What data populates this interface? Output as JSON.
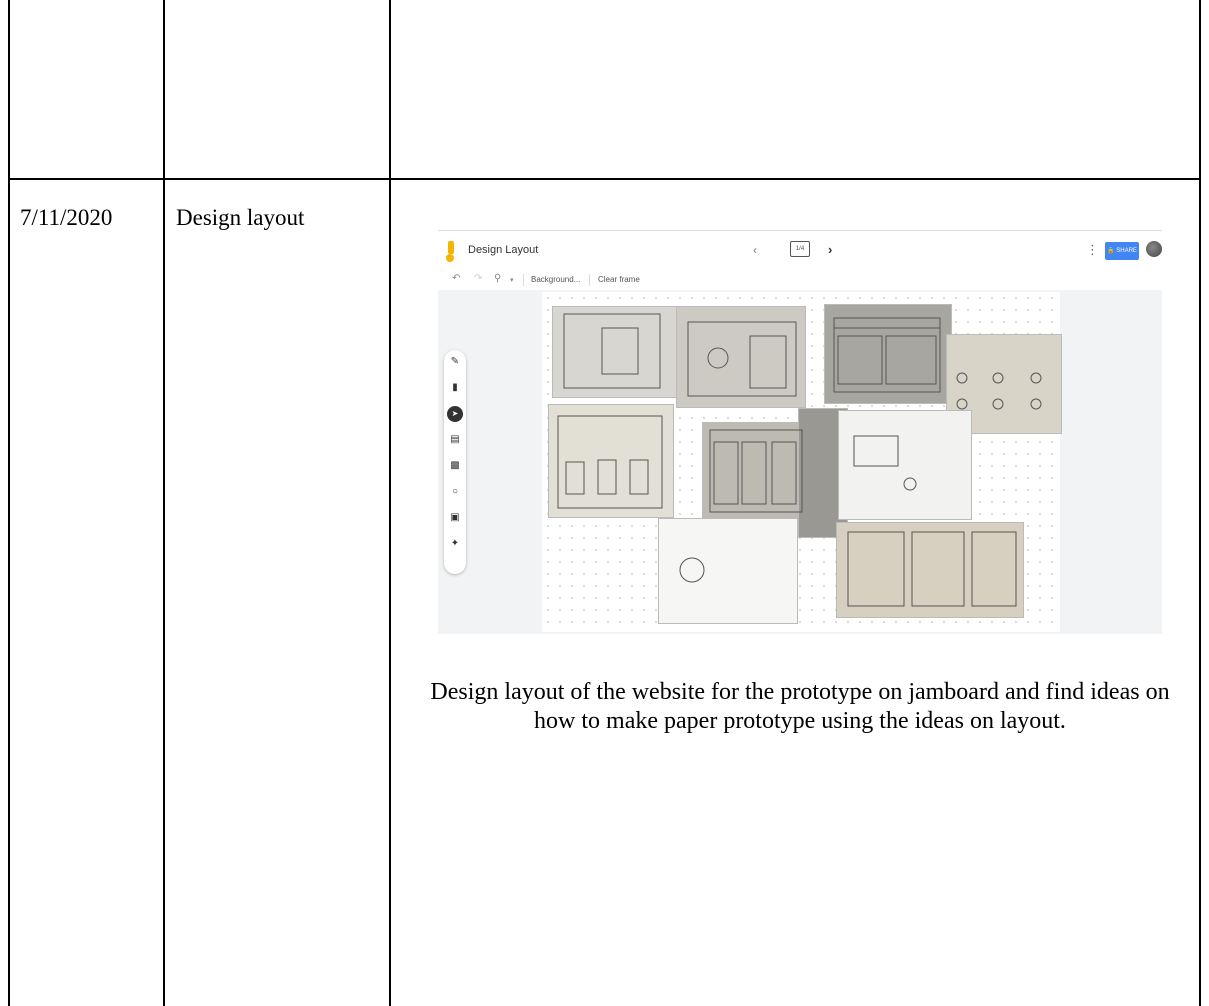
{
  "rows": [
    {
      "date": "",
      "title": ""
    },
    {
      "date": "7/11/2020",
      "title": "Design layout"
    }
  ],
  "jamboard": {
    "title": "Design Layout",
    "frame_indicator": "1/4",
    "share_label": "SHARE",
    "toolbar": {
      "background_label": "Background...",
      "clear_label": "Clear frame"
    },
    "colors": {
      "accent": "#4285f4",
      "logo": "#f4b400",
      "canvas": "#ffffff",
      "chrome": "#f1f3f4"
    }
  },
  "description": "Design layout of the website for the prototype on jamboard and find ideas on how to make paper prototype using the ideas on layout."
}
